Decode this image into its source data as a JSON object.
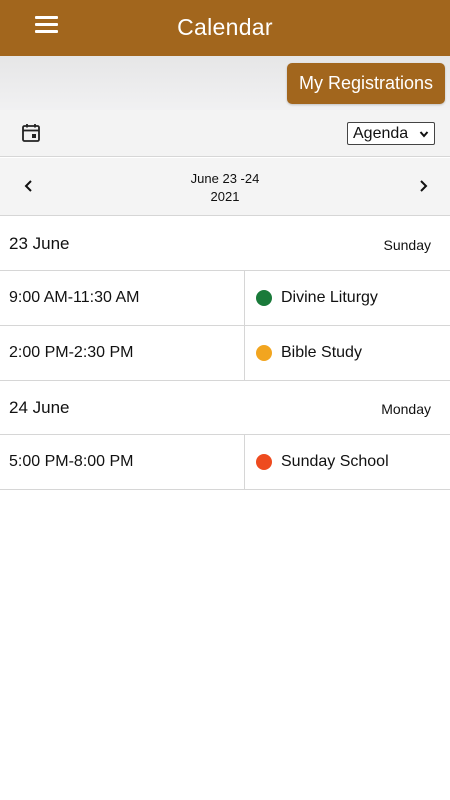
{
  "header": {
    "title": "Calendar",
    "menu_icon": "hamburger-menu-icon"
  },
  "registrations": {
    "label": "My Registrations"
  },
  "toolbar": {
    "calendar_icon": "calendar-icon",
    "view": {
      "selected": "Agenda"
    }
  },
  "range": {
    "line1": "June 23 -24",
    "line2": "2021"
  },
  "colors": {
    "brand": "#a2661d"
  },
  "days": [
    {
      "date": "23 June",
      "weekday": "Sunday",
      "events": [
        {
          "time": "9:00 AM-11:30 AM",
          "name": "Divine Liturgy",
          "color": "#1a7a3a"
        },
        {
          "time": "2:00 PM-2:30 PM",
          "name": "Bible Study",
          "color": "#f2a51f"
        }
      ]
    },
    {
      "date": "24 June",
      "weekday": "Monday",
      "events": [
        {
          "time": "5:00 PM-8:00 PM",
          "name": "Sunday School",
          "color": "#ee4b1f"
        }
      ]
    }
  ]
}
